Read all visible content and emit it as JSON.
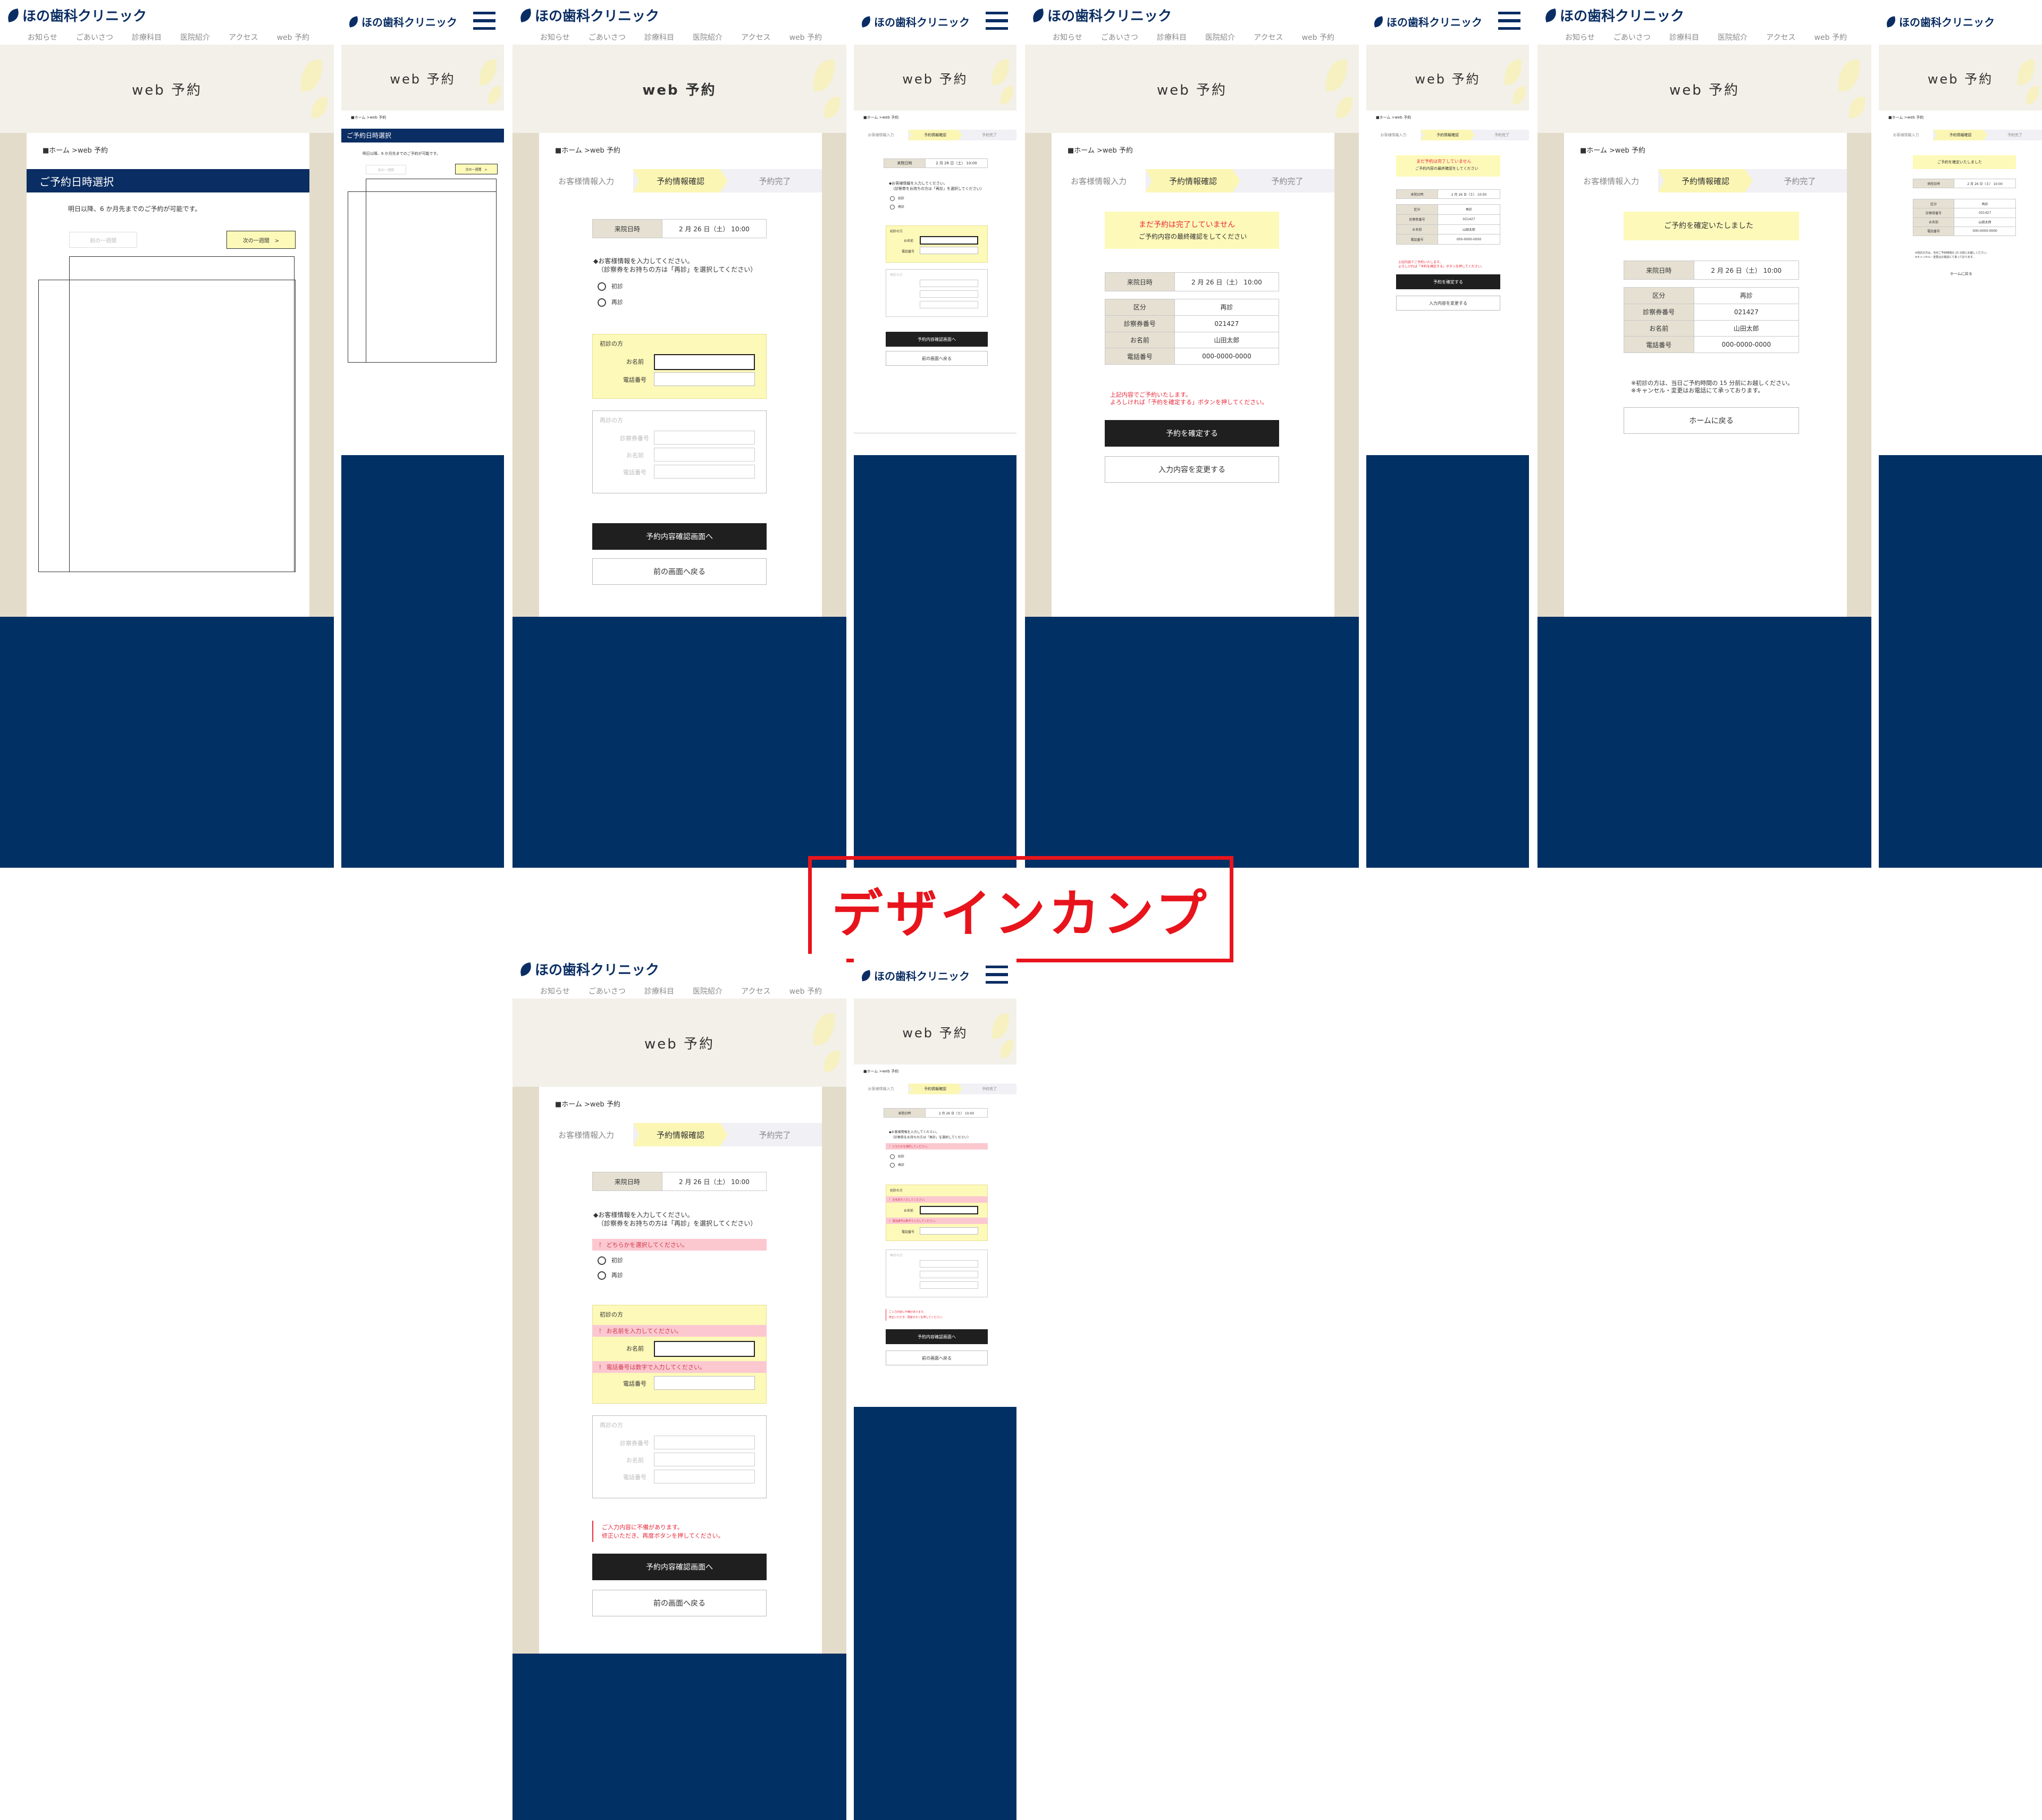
{
  "brand": {
    "name": "ほの歯科クリニック",
    "navy": "#003064",
    "accent_yellow": "#fdf9b9",
    "error_red": "#e8293a"
  },
  "nav": [
    "お知らせ",
    "ごあいさつ",
    "診療科目",
    "医院紹介",
    "アクセス",
    "web 予約"
  ],
  "hero_title": "web 予約",
  "breadcrumb": "■ホーム >web 予約",
  "breadcrumb_sp": "■ホーム >web 予約",
  "steps": [
    "お客様情報入力",
    "予約情報確認",
    "予約完了"
  ],
  "date_select": {
    "heading": "ご予約日時選択",
    "note": "明日以降、6 か月先までのご予約が可能です。",
    "prev": "前の一週間",
    "next": "次の一週間　>"
  },
  "form": {
    "date_label": "来院日時",
    "date_value": "2 月 26 日（土） 10:00",
    "instruction": "◆お客様情報を入力してください。",
    "instruction_sub": "（診察券をお持ちの方は「再診」を選択してください）",
    "radio_first": "初診",
    "radio_repeat": "再診",
    "first_title": "初診の方",
    "name_label": "お名前",
    "phone_label": "電話番号",
    "repeat_title": "再診の方",
    "card_label": "診察券番号",
    "submit": "予約内容確認画面へ",
    "back": "前の画面へ戻る"
  },
  "errors": {
    "choose": "！ どちらかを選択してください。",
    "name": "！ お名前を入力してください。",
    "phone": "！ 電話番号は数字で入力してください。",
    "summary1": "ご入力内容に不備があります。",
    "summary2": "修正いただき、再度ボタンを押してください。"
  },
  "confirm": {
    "notice_title": "まだ予約は完了していません",
    "notice_sub": "ご予約内容の最終確認をしてください",
    "kubun_label": "区分",
    "kubun_value": "再診",
    "card_label": "診察券番号",
    "card_value": "021427",
    "name_label": "お名前",
    "name_value": "山田太郎",
    "phone_label": "電話番号",
    "phone_value": "000-0000-0000",
    "warn1": "上記内容でご予約いたします。",
    "warn2": "よろしければ「予約を確定する」ボタンを押してください。",
    "confirm_btn": "予約を確定する",
    "change_btn": "入力内容を変更する"
  },
  "complete": {
    "title": "ご予約を確定いたしました",
    "note1": "※初診の方は、当日ご予約時間の 15 分前にお越しください。",
    "note2": "※キャンセル・変更はお電話にて承っております。",
    "home_btn": "ホームに戻る"
  },
  "caption": "デザインカンプ"
}
